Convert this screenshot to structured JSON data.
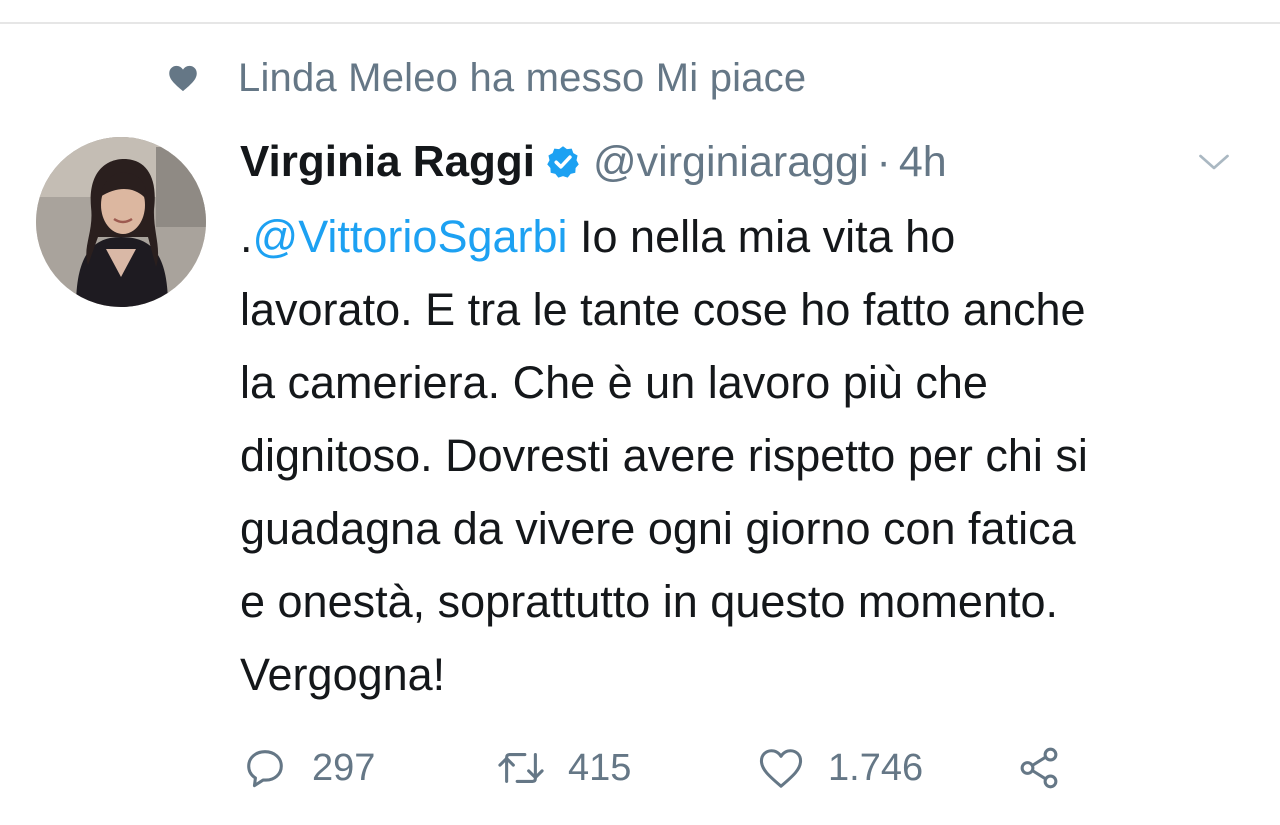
{
  "social_context": {
    "text": "Linda Meleo ha messo Mi piace",
    "icon": "heart-filled-icon"
  },
  "tweet": {
    "author": {
      "display_name": "Virginia Raggi",
      "handle": "@virginiaraggi",
      "verified": true
    },
    "separator": "·",
    "time": "4h",
    "text": {
      "prefix": ".",
      "mention": "@VittorioSgarbi",
      "body": " Io nella mia vita ho\nlavorato. E tra le tante cose ho fatto anche\nla cameriera. Che è un lavoro più che\ndignitoso. Dovresti avere rispetto per chi si\nguadagna da vivere ogni giorno con fatica\ne onestà, soprattutto in questo momento.\nVergogna!"
    },
    "actions": {
      "replies": "297",
      "retweets": "415",
      "likes": "1.746"
    }
  },
  "colors": {
    "accent": "#1da1f2",
    "secondary_text": "#657786",
    "primary_text": "#14171a"
  }
}
